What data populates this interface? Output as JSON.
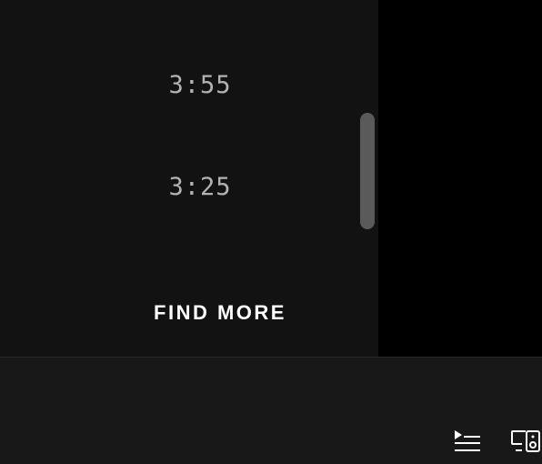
{
  "tracklist": {
    "durations": [
      "3:55",
      "3:25"
    ]
  },
  "find_more": {
    "label": "FIND MORE"
  },
  "player_bar": {
    "icons": {
      "queue": "queue-icon",
      "devices": "connect-to-device-icon"
    }
  },
  "colors": {
    "content_background": "#121212",
    "side_background": "#000000",
    "player_bar_background": "#181818",
    "duration_text": "#b3b3b3",
    "scrollbar_thumb": "#5a5a5a",
    "primary_text": "#ffffff"
  }
}
